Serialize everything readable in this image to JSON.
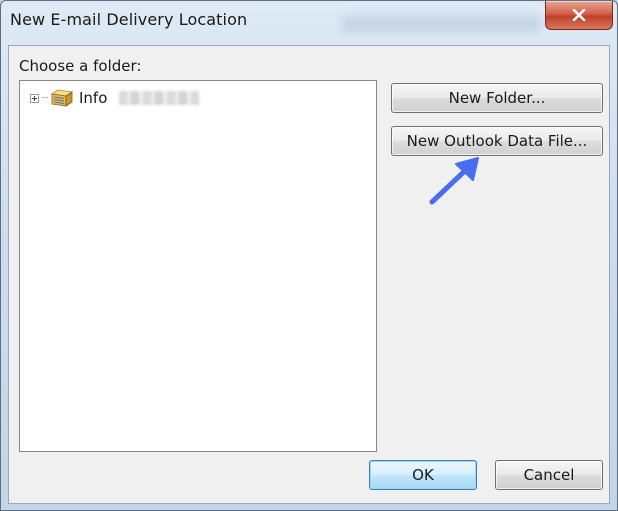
{
  "window": {
    "title": "New E-mail Delivery Location",
    "close_label": "Close"
  },
  "dialog": {
    "choose_label": "Choose a folder:",
    "tree": {
      "items": [
        {
          "label": "Info",
          "expanded": false,
          "icon": "data-file-folder-icon"
        }
      ]
    },
    "buttons": {
      "new_folder": "New Folder...",
      "new_outlook_data_file": "New Outlook Data File...",
      "ok": "OK",
      "cancel": "Cancel"
    }
  },
  "annotation": {
    "arrow_color": "#4a6cf0",
    "points_to": "new-outlook-data-file-button"
  },
  "colors": {
    "close_button": "#c7432d",
    "ok_button_border": "#3c7fb1",
    "dialog_background": "#f0f0f0"
  }
}
